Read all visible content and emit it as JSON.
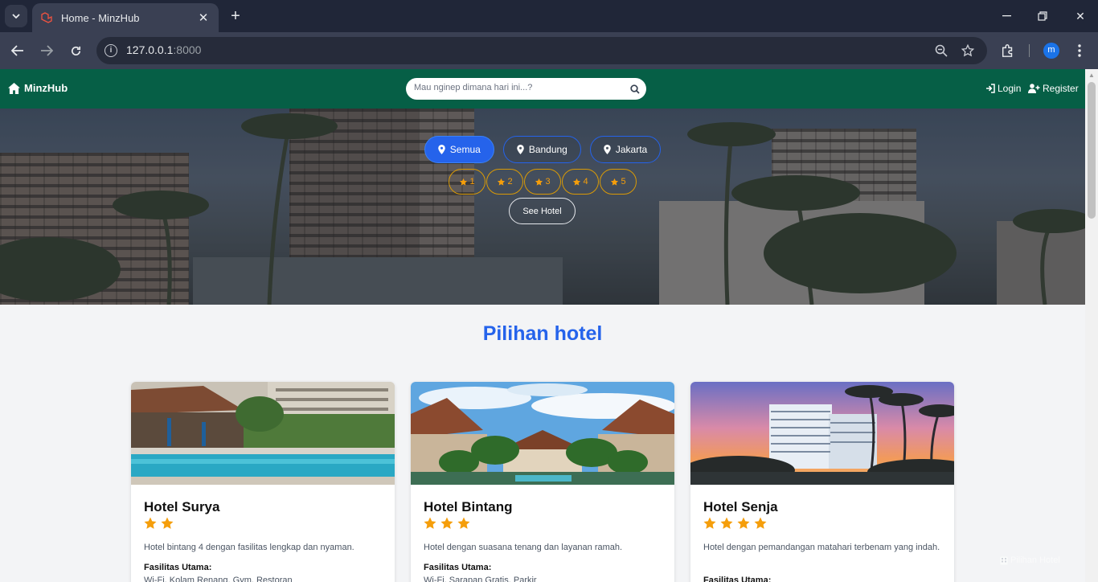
{
  "browser": {
    "tab_title": "Home - MinzHub",
    "url_host": "127.0.0.1",
    "url_port": ":8000",
    "profile_initial": "m"
  },
  "navbar": {
    "brand": "MinzHub",
    "search_placeholder": "Mau nginep dimana hari ini...?",
    "login": "Login",
    "register": "Register"
  },
  "hero": {
    "cities": [
      {
        "label": "Semua",
        "active": true
      },
      {
        "label": "Bandung",
        "active": false
      },
      {
        "label": "Jakarta",
        "active": false
      }
    ],
    "stars": [
      "1",
      "2",
      "3",
      "4",
      "5"
    ],
    "see_button": "See Hotel"
  },
  "main": {
    "title": "Pilihan hotel",
    "hotels": [
      {
        "name": "Hotel Surya",
        "stars": 2,
        "description": "Hotel bintang 4 dengan fasilitas lengkap dan nyaman.",
        "facilities_label": "Fasilitas Utama:",
        "facilities": "Wi-Fi, Kolam Renang, Gym, Restoran"
      },
      {
        "name": "Hotel Bintang",
        "stars": 3,
        "description": "Hotel dengan suasana tenang dan layanan ramah.",
        "facilities_label": "Fasilitas Utama:",
        "facilities": "Wi-Fi, Sarapan Gratis, Parkir"
      },
      {
        "name": "Hotel Senja",
        "stars": 4,
        "description": "Hotel dengan pemandangan matahari terbenam yang indah.",
        "facilities_label": "Fasilitas Utama:",
        "facilities": ""
      }
    ]
  },
  "floating_label": "Pilihan Hotel",
  "colors": {
    "navbar": "#065f46",
    "accent_blue": "#2563eb",
    "star": "#f59e0b"
  }
}
